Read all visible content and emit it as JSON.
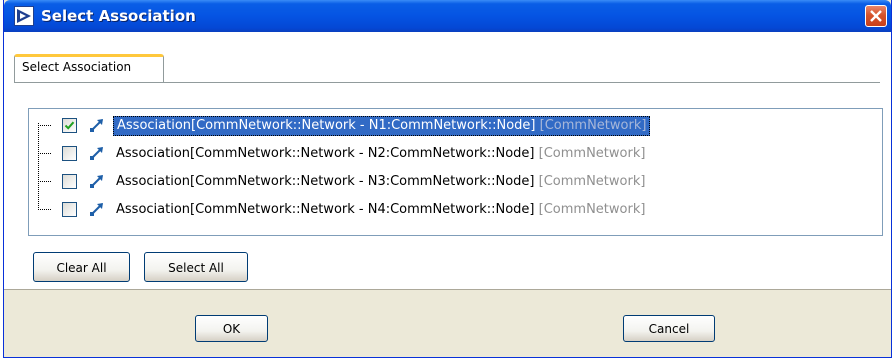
{
  "window": {
    "title": "Select Association",
    "accent_color": "#0554e3",
    "close_color": "#d6542c"
  },
  "tab": {
    "label": "Select Association"
  },
  "tree": {
    "selected_color": "#316ac5",
    "items": [
      {
        "label": "Association[CommNetwork::Network - N1:CommNetwork::Node]",
        "owner": "[CommNetwork]",
        "checked": true,
        "selected": true
      },
      {
        "label": "Association[CommNetwork::Network - N2:CommNetwork::Node]",
        "owner": "[CommNetwork]",
        "checked": false,
        "selected": false
      },
      {
        "label": "Association[CommNetwork::Network - N3:CommNetwork::Node]",
        "owner": "[CommNetwork]",
        "checked": false,
        "selected": false
      },
      {
        "label": "Association[CommNetwork::Network - N4:CommNetwork::Node]",
        "owner": "[CommNetwork]",
        "checked": false,
        "selected": false
      }
    ]
  },
  "actions": {
    "clear_all": "Clear All",
    "select_all": "Select All"
  },
  "footer": {
    "ok": "OK",
    "cancel": "Cancel"
  }
}
